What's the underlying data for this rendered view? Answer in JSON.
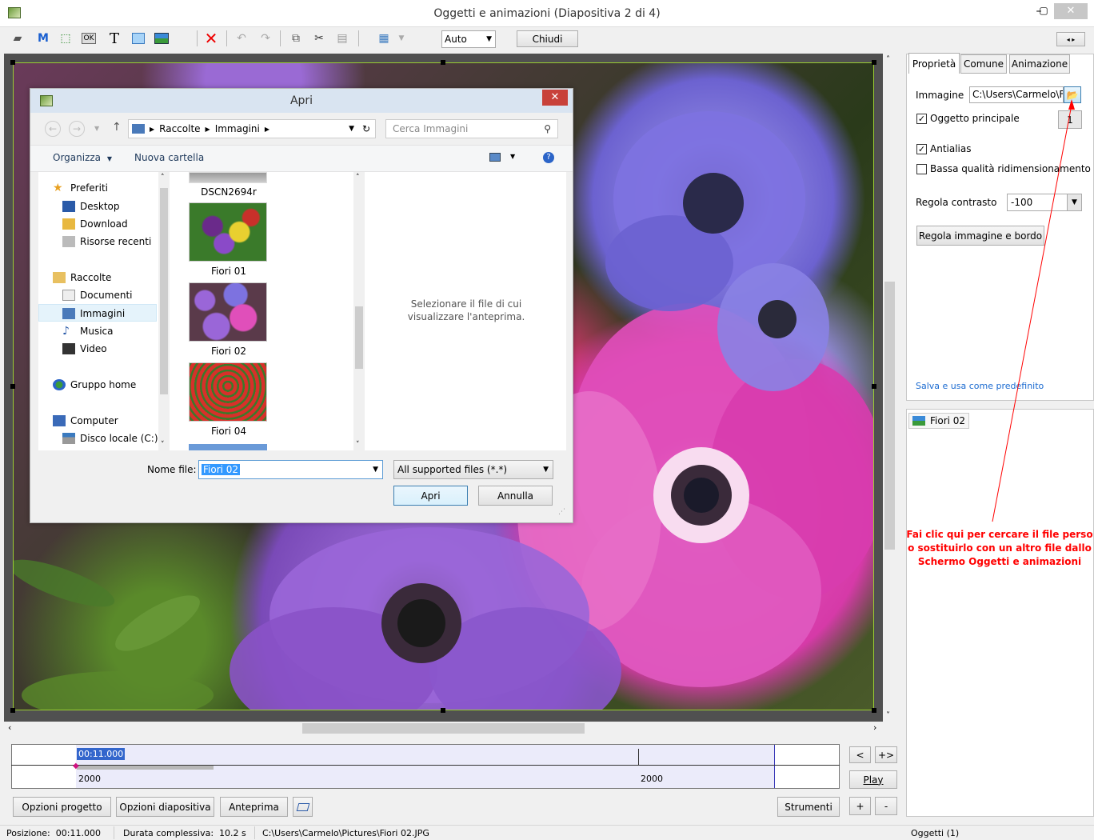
{
  "window": {
    "title": "Oggetti e animazioni  (Diapositiva 2 di 4)"
  },
  "toolbar": {
    "zoom_value": "Auto",
    "close_label": "Chiudi"
  },
  "dialog": {
    "title": "Apri",
    "breadcrumb": [
      "Raccolte",
      "Immagini"
    ],
    "search_placeholder": "Cerca Immagini",
    "organize_label": "Organizza",
    "new_folder_label": "Nuova cartella",
    "nav": {
      "favorites": "Preferiti",
      "desktop": "Desktop",
      "download": "Download",
      "recent": "Risorse recenti",
      "libraries": "Raccolte",
      "documents": "Documenti",
      "pictures": "Immagini",
      "music": "Musica",
      "video": "Video",
      "homegroup": "Gruppo home",
      "computer": "Computer",
      "local_disk": "Disco locale (C:)"
    },
    "files": [
      "DSCN2694r",
      "Fiori 01",
      "Fiori 02",
      "Fiori 04"
    ],
    "preview_text": "Selezionare il file di cui visualizzare l'anteprima.",
    "filename_label": "Nome file:",
    "filename_value": "Fiori 02",
    "filter_value": "All supported files (*.*)",
    "open_label": "Apri",
    "cancel_label": "Annulla"
  },
  "props": {
    "tabs": [
      "Proprietà",
      "Comune",
      "Animazione"
    ],
    "image_label": "Immagine",
    "image_path": "C:\\Users\\Carmelo\\F",
    "main_object_label": "Oggetto principale",
    "main_object_value": "1",
    "antialias_label": "Antialias",
    "low_quality_label": "Bassa qualità ridimensionamento",
    "contrast_label": "Regola contrasto",
    "contrast_value": "-100",
    "adjust_button": "Regola immagine e bordo",
    "save_default_link": "Salva e usa come predefinito"
  },
  "objects_list": {
    "item": "Fiori 02"
  },
  "annotation": {
    "text": "Fai clic qui per cercare il file perso o sostituirlo con un altro file dallo Schermo Oggetti e animazioni",
    "color": "#ff0000"
  },
  "timeline": {
    "current_time": "00:11.000",
    "marker_left": "2000",
    "marker_right": "2000"
  },
  "bottom": {
    "project_options": "Opzioni progetto",
    "slide_options": "Opzioni diapositiva",
    "preview": "Anteprima",
    "tools": "Strumenti",
    "play": "Play",
    "prev": "<",
    "next_plus": "+>",
    "plus": "+",
    "minus": "-"
  },
  "status": {
    "position": "Posizione:  00:11.000",
    "duration": "Durata complessiva:  10.2 s",
    "path": "C:\\Users\\Carmelo\\Pictures\\Fiori 02.JPG",
    "objects": "Oggetti (1)"
  }
}
